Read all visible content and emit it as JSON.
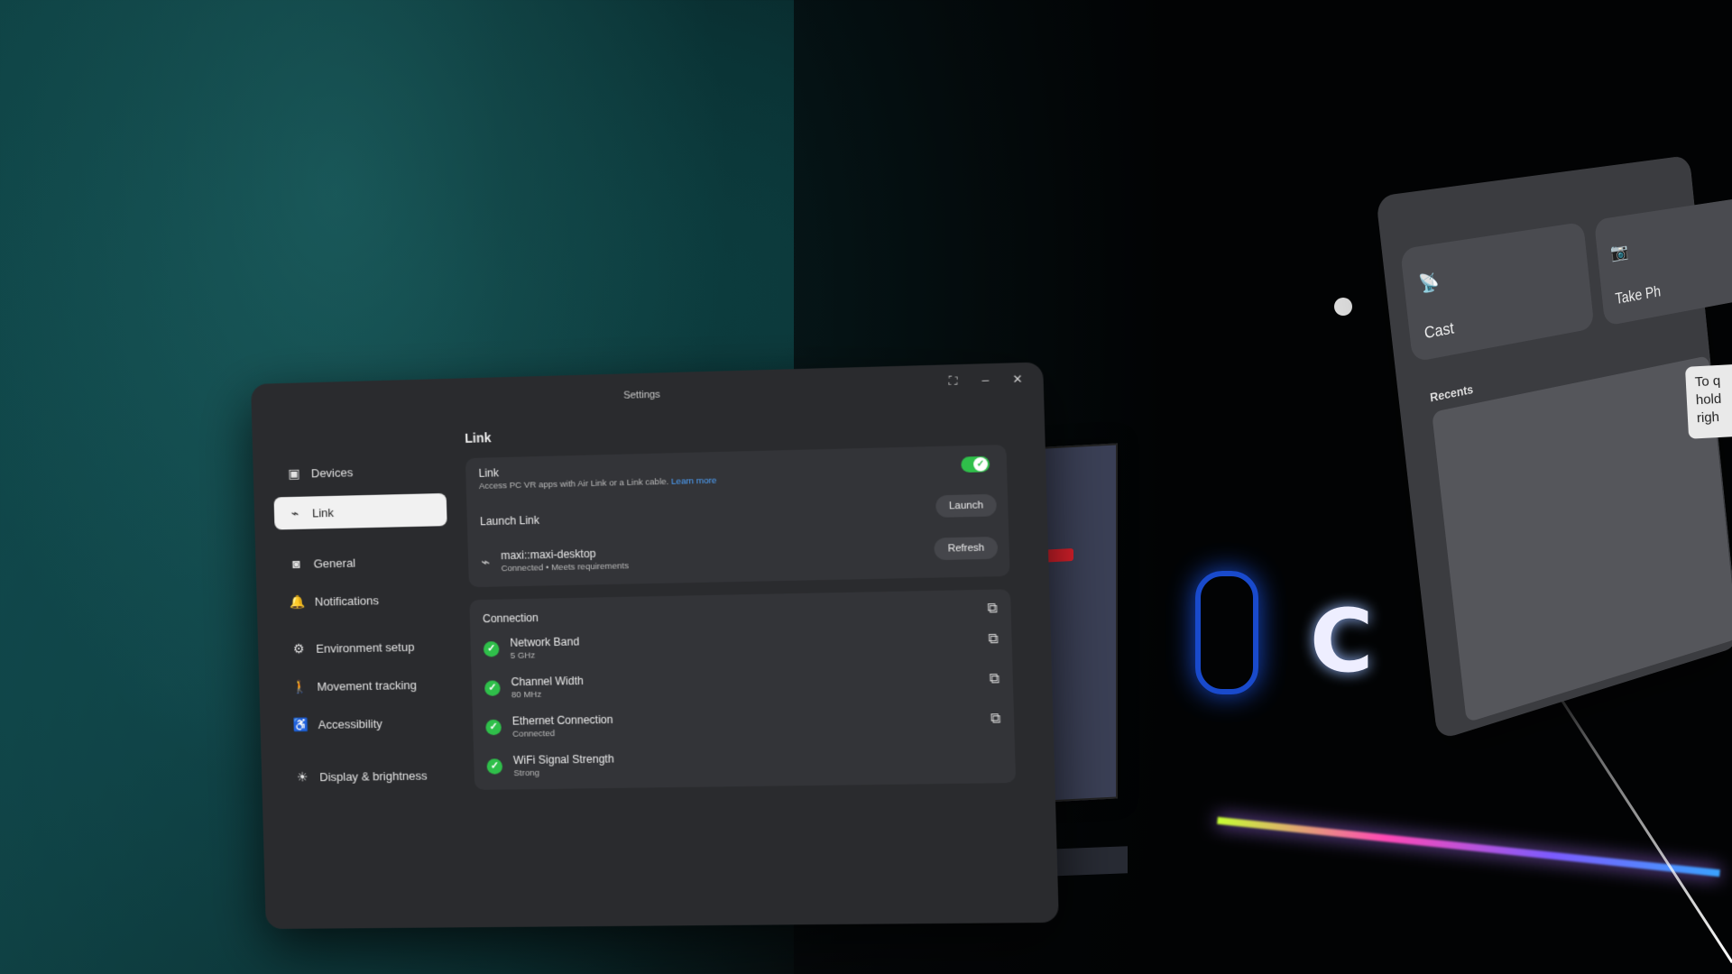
{
  "window": {
    "title": "Settings",
    "controls": {
      "restore": "⛶",
      "minimize": "–",
      "close": "✕"
    }
  },
  "sidebar": {
    "items": [
      {
        "label": "Devices",
        "icon": "devices-icon",
        "glyph": "▣"
      },
      {
        "label": "Link",
        "icon": "link-icon",
        "glyph": "⌁",
        "active": true
      },
      {
        "label": "General",
        "icon": "headset-icon",
        "glyph": "◙"
      },
      {
        "label": "Notifications",
        "icon": "bell-icon",
        "glyph": "🔔"
      },
      {
        "label": "Environment setup",
        "icon": "environment-icon",
        "glyph": "⚙"
      },
      {
        "label": "Movement tracking",
        "icon": "movement-icon",
        "glyph": "🚶"
      },
      {
        "label": "Accessibility",
        "icon": "accessibility-icon",
        "glyph": "♿"
      },
      {
        "label": "Display & brightness",
        "icon": "brightness-icon",
        "glyph": "☀"
      }
    ]
  },
  "link_page": {
    "title": "Link",
    "link_toggle": {
      "title": "Link",
      "subtitle": "Access PC VR apps with Air Link or a Link cable.",
      "learn_more": "Learn more",
      "enabled": true
    },
    "launch": {
      "title": "Launch Link",
      "button": "Launch"
    },
    "device": {
      "name": "maxi::maxi-desktop",
      "status": "Connected • Meets requirements",
      "button": "Refresh"
    },
    "connection": {
      "title": "Connection",
      "items": [
        {
          "title": "Network Band",
          "value": "5 GHz"
        },
        {
          "title": "Channel Width",
          "value": "80 MHz"
        },
        {
          "title": "Ethernet Connection",
          "value": "Connected"
        },
        {
          "title": "WiFi Signal Strength",
          "value": "Strong"
        }
      ]
    }
  },
  "quick_panel": {
    "tiles": [
      {
        "label": "Cast",
        "icon": "cast-icon"
      },
      {
        "label": "Take Ph",
        "icon": "camera-icon"
      }
    ],
    "recents_label": "Recents",
    "tooltip": "To q\nhold\nrigh"
  },
  "colors": {
    "toggle_on": "#2fbf4a",
    "link_blue": "#4ea3ff",
    "panel_bg": "#2a2b2e"
  }
}
